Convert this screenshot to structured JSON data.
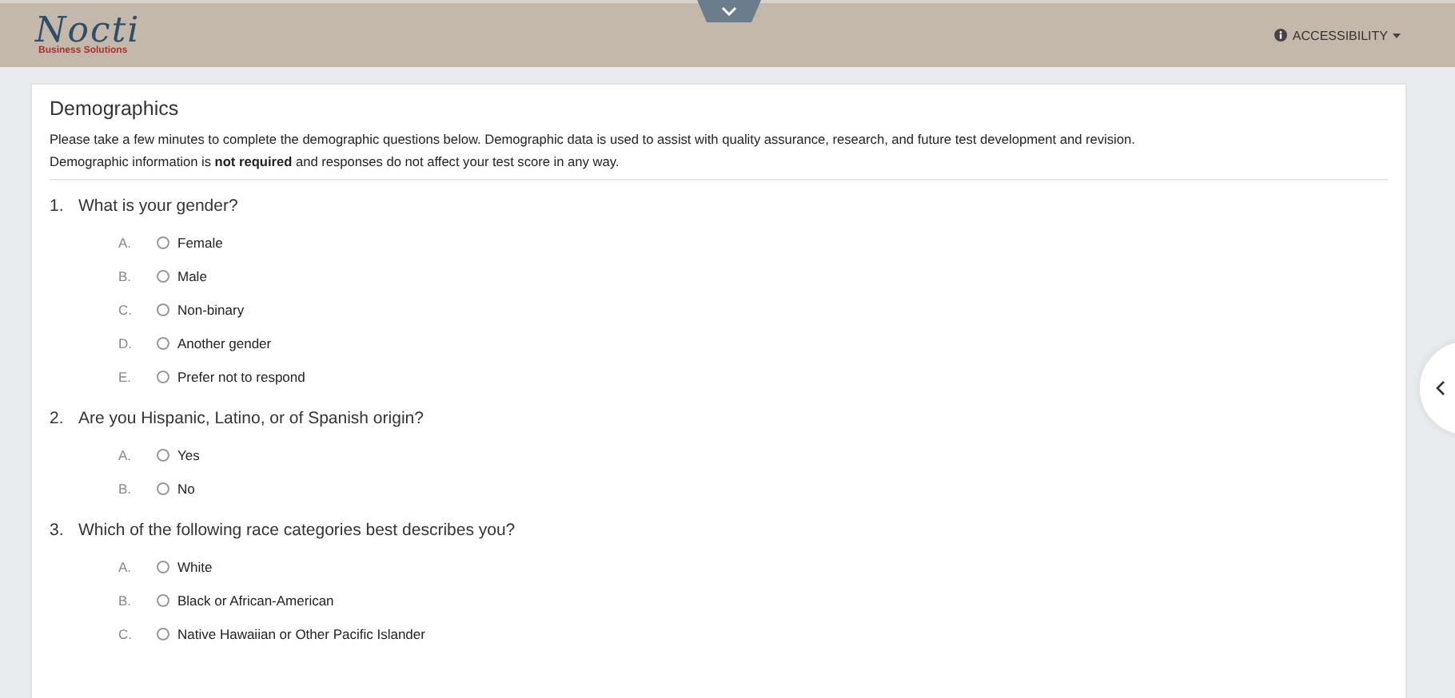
{
  "header": {
    "logo": {
      "name": "Nocti",
      "tagline": "Business Solutions"
    },
    "accessibility_menu": {
      "label": "ACCESSIBILITY"
    }
  },
  "card": {
    "title": "Demographics",
    "intro": [
      "Please take a few minutes to complete the demographic questions below. Demographic data is used to assist with quality assurance, research, and future test development and revision.",
      "Demographic information is **not required** and responses do not affect your test score in any way."
    ]
  },
  "questions": [
    {
      "number": "1.",
      "text": "What is your gender?",
      "options": [
        {
          "letter": "A.",
          "label": "Female",
          "selected": false
        },
        {
          "letter": "B.",
          "label": "Male",
          "selected": false
        },
        {
          "letter": "C.",
          "label": "Non-binary",
          "selected": false
        },
        {
          "letter": "D.",
          "label": "Another gender",
          "selected": false
        },
        {
          "letter": "E.",
          "label": "Prefer not to respond",
          "selected": false
        }
      ]
    },
    {
      "number": "2.",
      "text": "Are you Hispanic, Latino, or of Spanish origin?",
      "options": [
        {
          "letter": "A.",
          "label": "Yes",
          "selected": false
        },
        {
          "letter": "B.",
          "label": "No",
          "selected": false
        }
      ]
    },
    {
      "number": "3.",
      "text": "Which of the following race categories best describes you?",
      "options": [
        {
          "letter": "A.",
          "label": "White",
          "selected": false
        },
        {
          "letter": "B.",
          "label": "Black or African-American",
          "selected": false
        },
        {
          "letter": "C.",
          "label": "Native Hawaiian or Other Pacific Islander",
          "selected": false
        }
      ]
    }
  ]
}
